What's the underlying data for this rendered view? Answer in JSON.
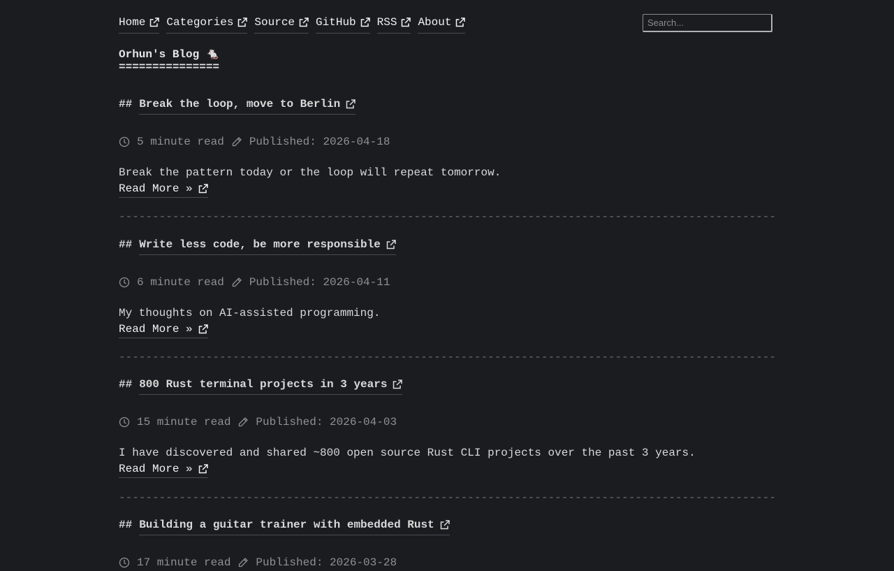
{
  "nav": {
    "items": [
      {
        "label": "Home"
      },
      {
        "label": "Categories"
      },
      {
        "label": "Source"
      },
      {
        "label": "GitHub"
      },
      {
        "label": "RSS"
      },
      {
        "label": "About"
      }
    ]
  },
  "search": {
    "placeholder": "Search..."
  },
  "blog": {
    "title": "Orhun's Blog 🐁",
    "underline": "==============="
  },
  "divider": "------------------------------------------------------------------------------------------------------------",
  "posts": [
    {
      "hash": "##",
      "title": "Break the loop, move to Berlin",
      "read_time": "5 minute read",
      "published": "Published: 2026-04-18",
      "summary": "Break the pattern today or the loop will repeat tomorrow.",
      "read_more": "Read More »"
    },
    {
      "hash": "##",
      "title": "Write less code, be more responsible",
      "read_time": "6 minute read",
      "published": "Published: 2026-04-11",
      "summary": "My thoughts on AI-assisted programming.",
      "read_more": "Read More »"
    },
    {
      "hash": "##",
      "title": "800 Rust terminal projects in 3 years",
      "read_time": "15 minute read",
      "published": "Published: 2026-04-03",
      "summary": "I have discovered and shared ~800 open source Rust CLI projects over the past 3 years.",
      "read_more": "Read More »"
    },
    {
      "hash": "##",
      "title": "Building a guitar trainer with embedded Rust",
      "read_time": "17 minute read",
      "published": "Published: 2026-03-28",
      "summary": "",
      "read_more": ""
    }
  ]
}
